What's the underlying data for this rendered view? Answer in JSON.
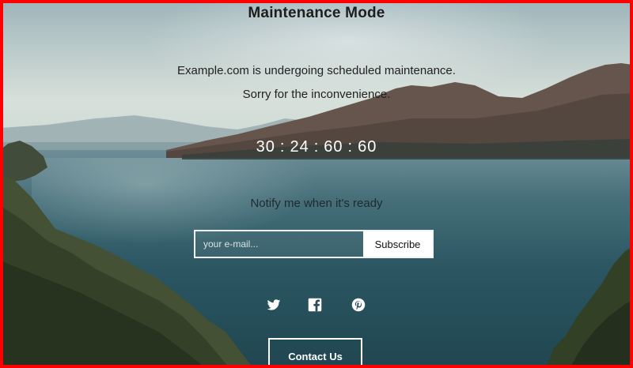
{
  "page": {
    "title": "Maintenance Mode",
    "message_line_1": "Example.com is undergoing scheduled maintenance.",
    "message_line_2": "Sorry for the inconvenience."
  },
  "countdown": {
    "days": "30",
    "hours": "24",
    "minutes": "60",
    "seconds": "60",
    "separator": ":"
  },
  "notify": {
    "heading": "Notify me when it's ready",
    "email_placeholder": "your e-mail...",
    "email_value": "",
    "subscribe_label": "Subscribe"
  },
  "social": [
    {
      "name": "twitter",
      "icon": "twitter-icon"
    },
    {
      "name": "facebook",
      "icon": "facebook-icon"
    },
    {
      "name": "pinterest",
      "icon": "pinterest-icon"
    }
  ],
  "contact": {
    "label": "Contact Us"
  },
  "colors": {
    "frame": "#ff0000",
    "lake": "#23505c",
    "text": "#1e1e1e",
    "button_bg": "#ffffff"
  }
}
